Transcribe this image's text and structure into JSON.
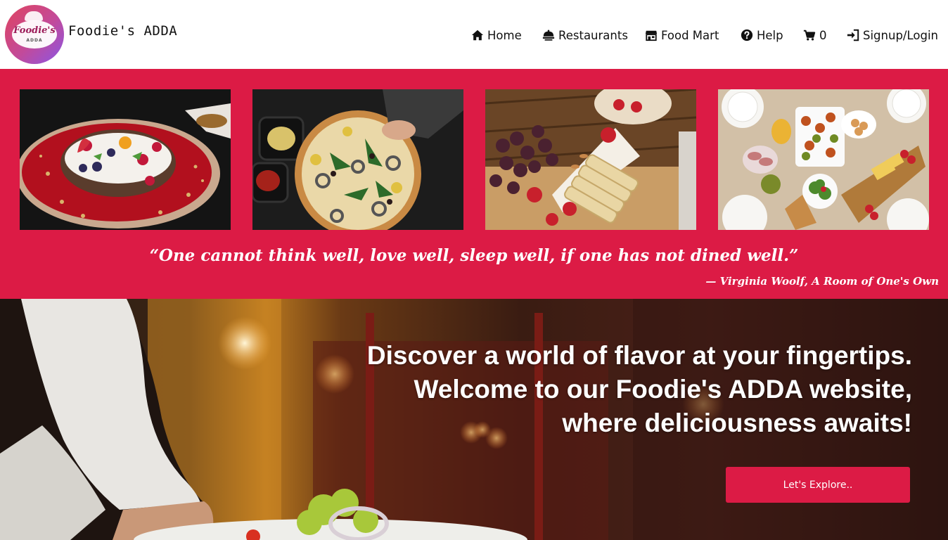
{
  "brand": {
    "name": "Foodie's ADDA",
    "logo_text": "Foodie's",
    "logo_subtext": "ADDA",
    "gradient": [
      "#e0445e",
      "#8a56e6"
    ]
  },
  "nav": {
    "items": [
      {
        "label": "Home",
        "icon": "home-icon"
      },
      {
        "label": "Restaurants",
        "icon": "restaurant-icon"
      },
      {
        "label": "Food Mart",
        "icon": "store-icon"
      },
      {
        "label": "Help",
        "icon": "question-icon"
      },
      {
        "label": "0",
        "icon": "cart-icon"
      },
      {
        "label": "Signup/Login",
        "icon": "login-icon"
      }
    ]
  },
  "gallery": {
    "images": [
      {
        "alt": "yogurt bowl with berries"
      },
      {
        "alt": "vegetable pizza"
      },
      {
        "alt": "cheese board with grapes"
      },
      {
        "alt": "table spread of dishes"
      }
    ],
    "quote": "“One cannot think well, love well, sleep well, if one has not dined well.”",
    "attribution": "— Virginia Woolf, A Room of One's Own"
  },
  "hero": {
    "headline_lines": [
      "Discover a world of flavor at your fingertips.",
      "Welcome to our Foodie's ADDA website,",
      "where deliciousness awaits!"
    ],
    "cta_label": "Let's Explore.."
  },
  "colors": {
    "accent": "#dc1b45",
    "header_bg": "#ffffff",
    "text": "#111111"
  }
}
